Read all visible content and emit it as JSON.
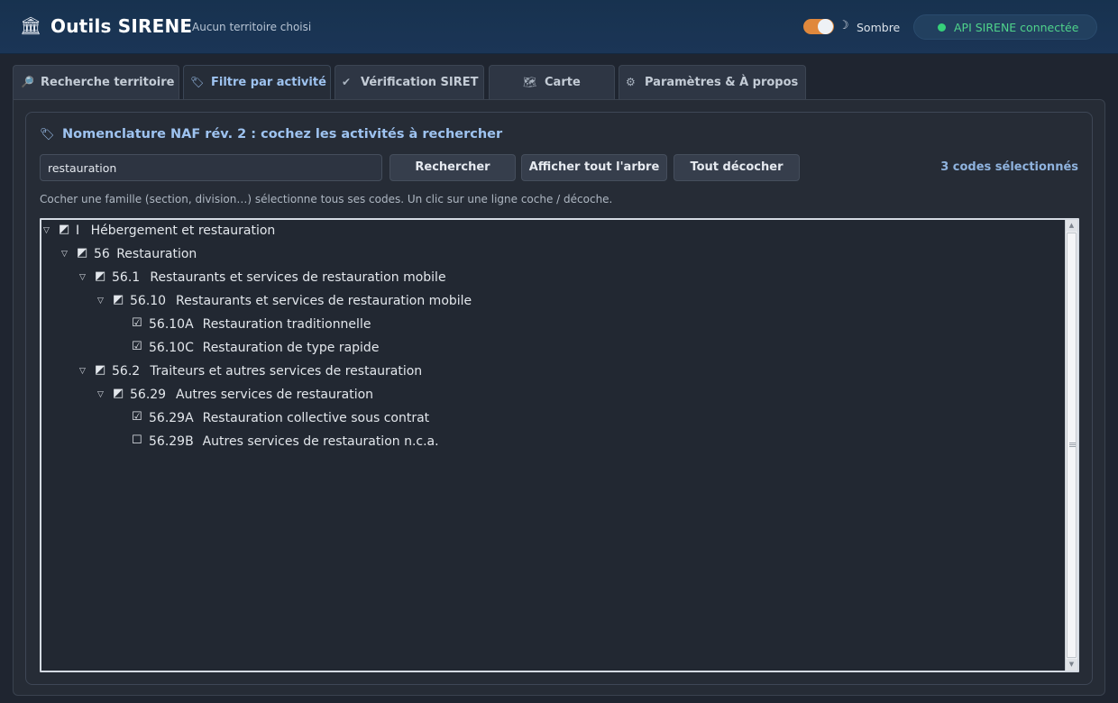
{
  "header": {
    "app_icon": "classical-building-icon",
    "title": "Outils SIRENE",
    "subtitle": "Aucun territoire choisi",
    "theme_label": "Sombre",
    "api_status": "API SIRENE connectée",
    "toggle_color": "#e0883c",
    "status_color": "#36d07a"
  },
  "tabs": [
    {
      "icon": "magnifier-icon",
      "glyph": "🔎",
      "label": "Recherche territoire"
    },
    {
      "icon": "label-tag-icon",
      "glyph": "🏷",
      "label": "Filtre par activité"
    },
    {
      "icon": "checkmark-icon",
      "glyph": "✔",
      "label": "Vérification SIRET"
    },
    {
      "icon": "map-icon",
      "glyph": "🗺",
      "label": "Carte"
    },
    {
      "icon": "gear-icon",
      "glyph": "⚙",
      "label": "Paramètres & À propos"
    }
  ],
  "main": {
    "section_icon": "label-tag-icon",
    "section_title": "Nomenclature NAF rév. 2 : cochez les activités à rechercher",
    "search_value": "restauration",
    "buttons": {
      "search": "Rechercher",
      "show_tree": "Afficher tout l'arbre",
      "uncheck_all": "Tout décocher"
    },
    "selected_count": "3 codes sélectionnés",
    "hint": "Cocher une famille (section, division…) sélectionne tous ses codes. Un clic sur une ligne coche / décoche."
  },
  "tree": [
    {
      "code": "I",
      "label": "Hébergement et restauration",
      "state": "partial",
      "expandable": true,
      "level": 0
    },
    {
      "code": "56",
      "label": "Restauration",
      "state": "partial",
      "expandable": true,
      "level": 1
    },
    {
      "code": "56.1",
      "label": "Restaurants et services de restauration mobile",
      "state": "partial",
      "expandable": true,
      "level": 2
    },
    {
      "code": "56.10",
      "label": "Restaurants et services de restauration mobile",
      "state": "partial",
      "expandable": true,
      "level": 3
    },
    {
      "code": "56.10A",
      "label": "Restauration traditionnelle",
      "state": "checked",
      "expandable": false,
      "level": 4
    },
    {
      "code": "56.10C",
      "label": "Restauration de type rapide",
      "state": "checked",
      "expandable": false,
      "level": 4
    },
    {
      "code": "56.2",
      "label": "Traiteurs et autres services de restauration",
      "state": "partial",
      "expandable": true,
      "level": 2
    },
    {
      "code": "56.29",
      "label": "Autres services de restauration",
      "state": "partial",
      "expandable": true,
      "level": 3
    },
    {
      "code": "56.29A",
      "label": "Restauration collective sous contrat",
      "state": "checked",
      "expandable": false,
      "level": 4
    },
    {
      "code": "56.29B",
      "label": "Autres services de restauration n.c.a.",
      "state": "unchecked",
      "expandable": false,
      "level": 4
    }
  ]
}
